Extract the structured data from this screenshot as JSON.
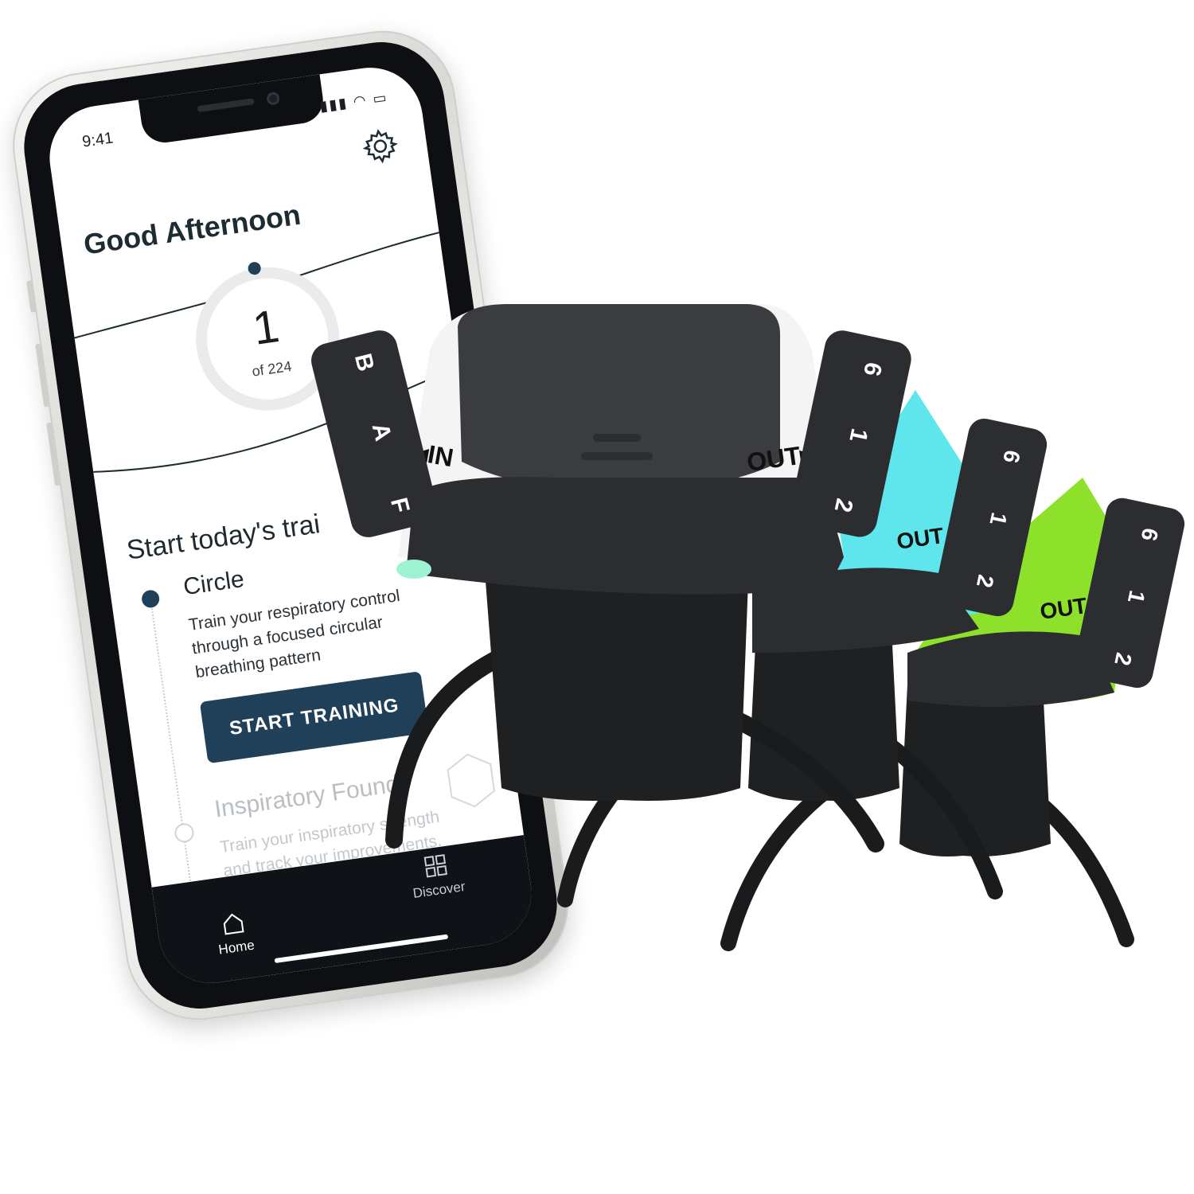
{
  "status": {
    "time": "9:41"
  },
  "app": {
    "greeting": "Good Afternoon",
    "progress": {
      "current": "1",
      "total_label": "of 224"
    },
    "section_title": "Start today's trai",
    "trainings": [
      {
        "title": "Circle",
        "description": "Train your respiratory control through a focused circular breathing pattern",
        "active": true
      },
      {
        "title": "Inspiratory Found.",
        "description": "Train your inspiratory strength and track your improvements.",
        "active": false
      }
    ],
    "start_button": "START TRAINING",
    "nav": {
      "home": "Home",
      "discover": "Discover"
    }
  },
  "icons": [
    "gear-icon",
    "signal-icon",
    "wifi-icon",
    "battery-icon",
    "home-icon",
    "grid-icon",
    "hexagon-icon"
  ],
  "devices": [
    {
      "accent": "#ffffff",
      "labels": {
        "in": "IN",
        "out": "OUT"
      },
      "left_dial": [
        "B",
        "A",
        "F"
      ],
      "right_dial": [
        "6",
        "1",
        "2"
      ]
    },
    {
      "accent": "#5ee6ec",
      "labels": {
        "out": "OUT"
      },
      "right_dial": [
        "6",
        "1",
        "2"
      ]
    },
    {
      "accent": "#8ee12a",
      "labels": {
        "out": "OUT"
      },
      "right_dial": [
        "6",
        "1",
        "2"
      ]
    }
  ],
  "colors": {
    "primary": "#1f4058",
    "device_body": "#2b2d30",
    "cyan": "#5ee6ec",
    "lime": "#8ee12a"
  }
}
